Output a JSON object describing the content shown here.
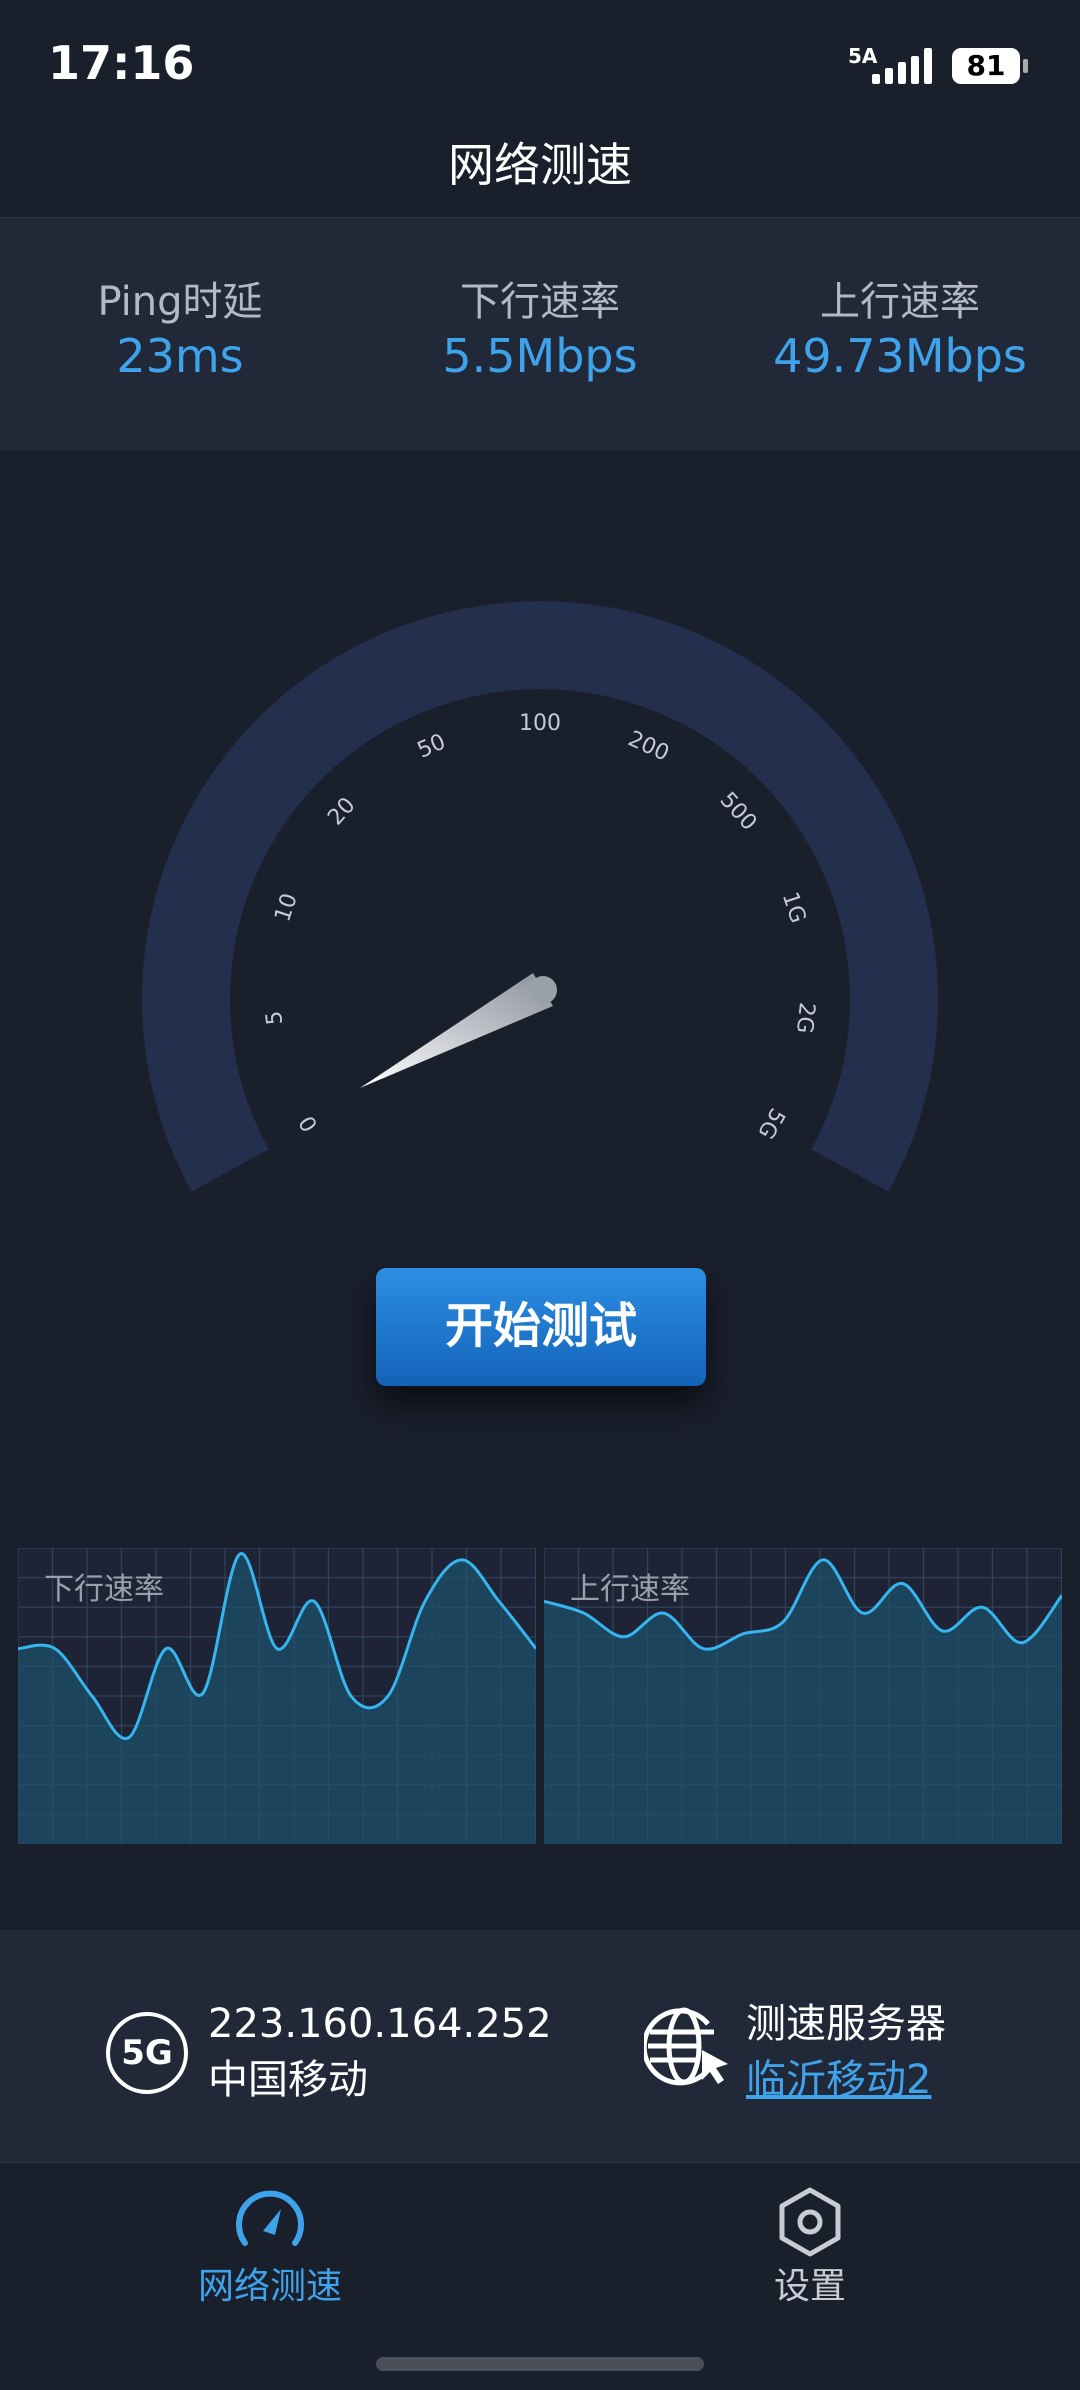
{
  "status_bar": {
    "time": "17:16",
    "network_type": "5A",
    "battery_level": "81"
  },
  "header": {
    "title": "网络测速"
  },
  "stats": [
    {
      "label": "Ping时延",
      "value": "23ms"
    },
    {
      "label": "下行速率",
      "value": "5.5Mbps"
    },
    {
      "label": "上行速率",
      "value": "49.73Mbps"
    }
  ],
  "gauge": {
    "ticks": [
      "0",
      "5",
      "10",
      "20",
      "50",
      "100",
      "200",
      "500",
      "1G",
      "2G",
      "5G"
    ],
    "needle_value": "0"
  },
  "start_button": {
    "label": "开始测试"
  },
  "charts": {
    "download": {
      "label": "下行速率",
      "values": [
        0.66,
        0.66,
        0.5,
        0.36,
        0.66,
        0.51,
        0.98,
        0.66,
        0.82,
        0.5,
        0.5,
        0.82,
        0.96,
        0.82,
        0.66
      ]
    },
    "upload": {
      "label": "上行速率",
      "values": [
        0.82,
        0.78,
        0.7,
        0.78,
        0.66,
        0.71,
        0.75,
        0.96,
        0.78,
        0.88,
        0.72,
        0.8,
        0.68,
        0.84
      ]
    }
  },
  "info": {
    "carrier_badge": "5G",
    "ip": "223.160.164.252",
    "carrier": "中国移动",
    "server_label": "测速服务器",
    "server_name": "临沂移动2"
  },
  "tabs": [
    {
      "label": "网络测速",
      "icon": "speedometer-icon",
      "active": true
    },
    {
      "label": "设置",
      "icon": "settings-hexagon-icon",
      "active": false
    }
  ],
  "colors": {
    "background": "#1a1f2c",
    "panel": "#212838",
    "accent": "#3ea3ea",
    "gauge_track": "#232f4d",
    "chart_line": "#35b6f0",
    "chart_fill": "#1d4a64"
  }
}
